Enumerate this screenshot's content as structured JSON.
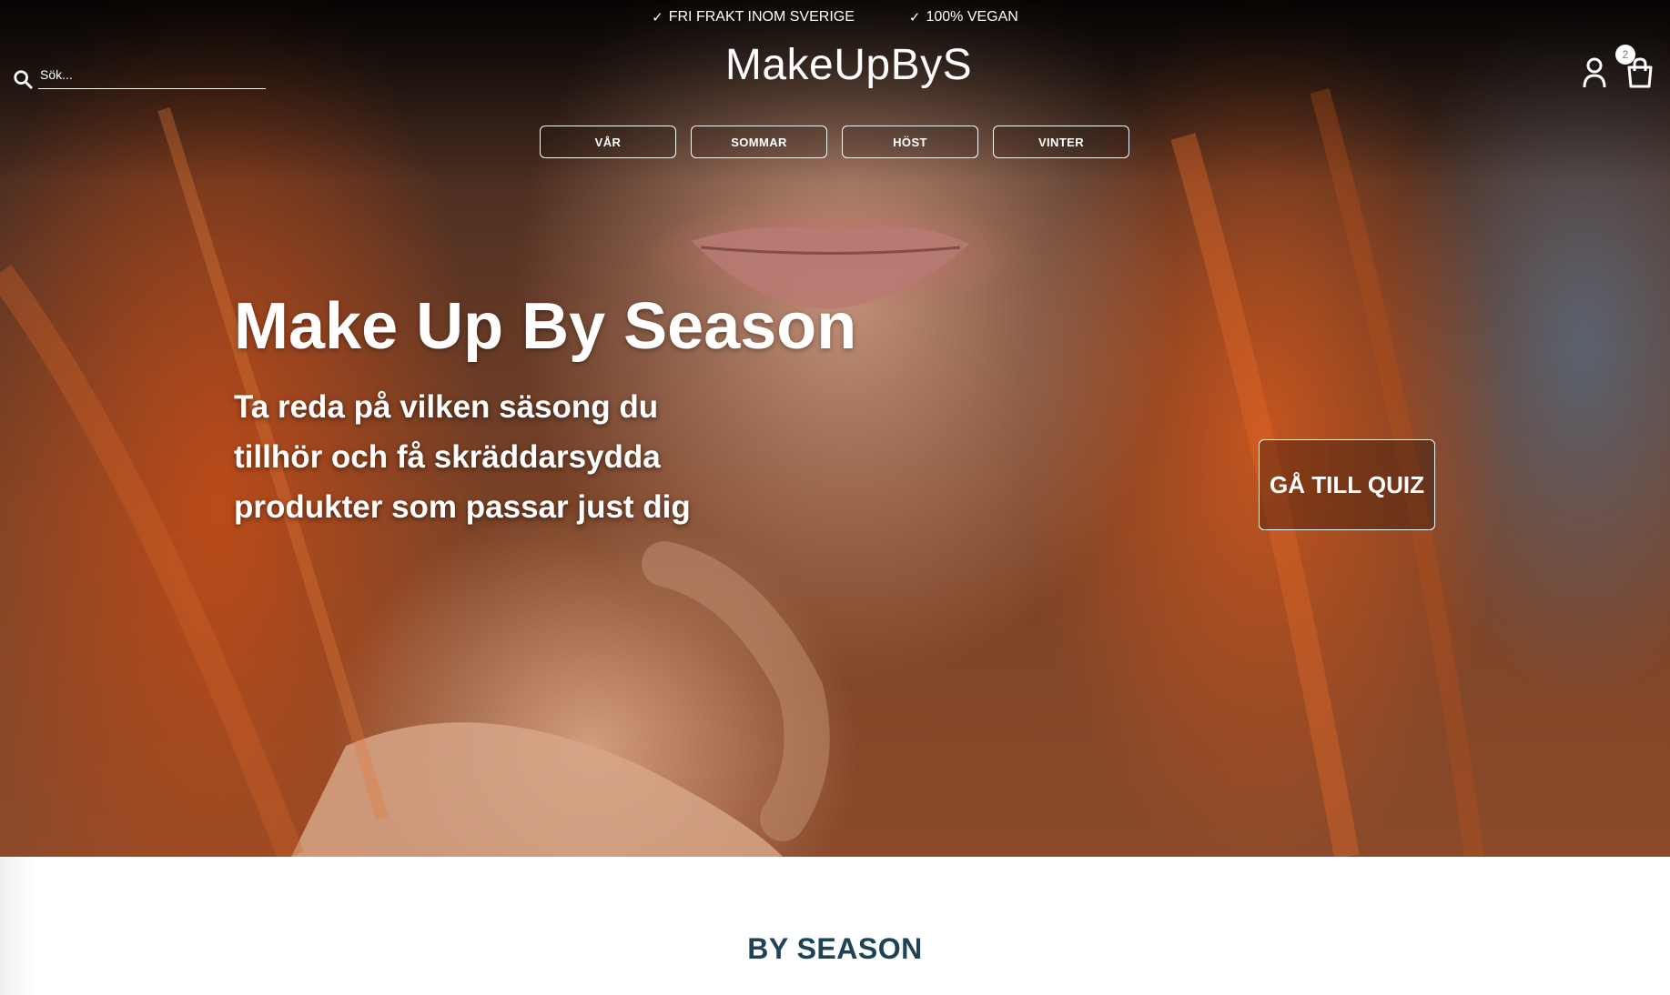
{
  "topbar": {
    "usps": [
      {
        "icon": "check-icon",
        "label": "FRI FRAKT INOM SVERIGE"
      },
      {
        "icon": "check-icon",
        "label": "100% VEGAN"
      }
    ]
  },
  "header": {
    "search_placeholder": "Sök...",
    "logo": "MakeUpByS",
    "cart_count": "2"
  },
  "season_nav": [
    "VÅR",
    "SOMMAR",
    "HÖST",
    "VINTER"
  ],
  "hero": {
    "title": "Make Up By Season",
    "subtitle": "Ta reda på vilken säsong du tillhör och få skräddarsydda produkter som passar just dig",
    "cta_label": "GÅ TILL QUIZ"
  },
  "section": {
    "title": "BY SEASON"
  },
  "colors": {
    "section_title": "#1e4356",
    "hero_hair": "#c8551e"
  }
}
